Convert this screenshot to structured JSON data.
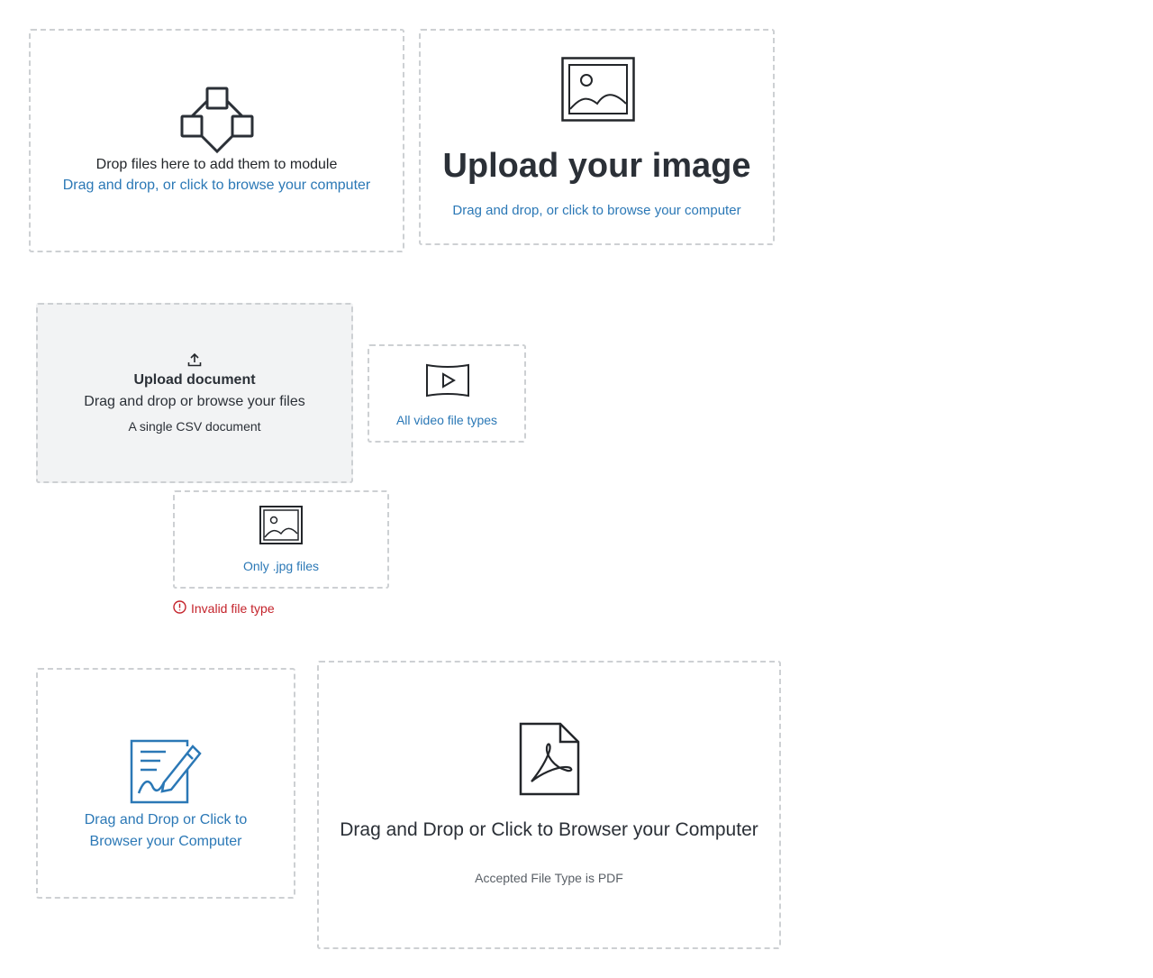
{
  "colors": {
    "link_blue": "#2b78b6",
    "text_dark": "#2b3037",
    "error_red": "#c4232b",
    "dashed_border": "#cdd0d3",
    "zone_gray_bg": "#f2f3f4"
  },
  "zones": [
    {
      "icon": "module-icon",
      "primary": "Drop files here to add them to module",
      "secondary": "Drag and drop, or click to browse your computer"
    },
    {
      "icon": "image-icon",
      "title": "Upload your image",
      "secondary": "Drag and drop, or click to browse your computer"
    },
    {
      "icon": "upload-arrow-icon",
      "title": "Upload document",
      "primary": "Drag and drop or browse your files",
      "hint": "A single CSV document"
    },
    {
      "icon": "video-icon",
      "secondary": "All video file types"
    },
    {
      "icon": "image-icon",
      "secondary": "Only .jpg files",
      "error": {
        "icon": "alert-circle-icon",
        "text": "Invalid file type"
      }
    },
    {
      "icon": "document-edit-icon",
      "secondary": "Drag and Drop or Click to Browser your Computer"
    },
    {
      "icon": "pdf-file-icon",
      "title": "Drag and Drop or Click to Browser your Computer",
      "hint": "Accepted File Type is PDF"
    }
  ]
}
